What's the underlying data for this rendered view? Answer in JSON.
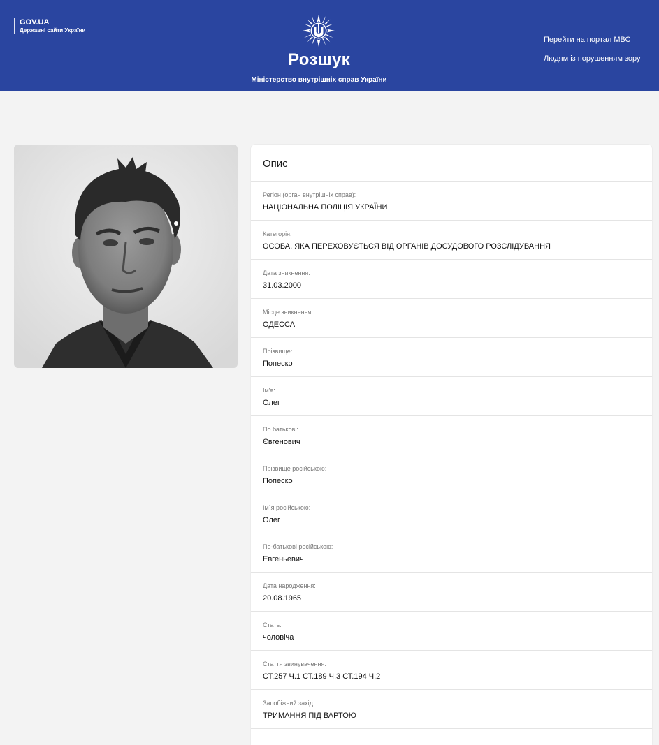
{
  "header": {
    "gov_title": "GOV.UA",
    "gov_subtitle": "Державні сайти України",
    "site_title": "Розшук",
    "site_subtitle": "Міністерство внутрішніх справ України",
    "nav": [
      "Перейти на портал МВС",
      "Людям із порушенням зору"
    ],
    "emblem_icon": "ukraine-police-emblem-icon",
    "background_color": "#2a45a0"
  },
  "card": {
    "title": "Опис",
    "fields": [
      {
        "label": "Регіон (орган внутрішніх справ):",
        "value": "НАЦІОНАЛЬНА ПОЛІЦІЯ УКРАЇНИ"
      },
      {
        "label": "Категорія:",
        "value": "ОСОБА, ЯКА ПЕРЕХОВУЄТЬСЯ ВІД ОРГАНІВ ДОСУДОВОГО РОЗСЛІДУВАННЯ"
      },
      {
        "label": "Дата зникнення:",
        "value": "31.03.2000"
      },
      {
        "label": "Місце зникнення:",
        "value": "ОДЕССА"
      },
      {
        "label": "Прізвище:",
        "value": "Попеско"
      },
      {
        "label": "Ім'я:",
        "value": "Олег"
      },
      {
        "label": "По батькові:",
        "value": "Євгенович"
      },
      {
        "label": "Прізвище російською:",
        "value": "Попеско"
      },
      {
        "label": "Ім`я російською:",
        "value": "Олег"
      },
      {
        "label": "По-батькові російською:",
        "value": "Евгеньевич"
      },
      {
        "label": "Дата народження:",
        "value": "20.08.1965"
      },
      {
        "label": "Стать:",
        "value": "чоловіча"
      },
      {
        "label": "Стаття звинувачення:",
        "value": "СТ.257 Ч.1 СТ.189 Ч.3 СТ.194 Ч.2"
      },
      {
        "label": "Запобіжний захід:",
        "value": "ТРИМАННЯ ПІД ВАРТОЮ"
      }
    ]
  }
}
